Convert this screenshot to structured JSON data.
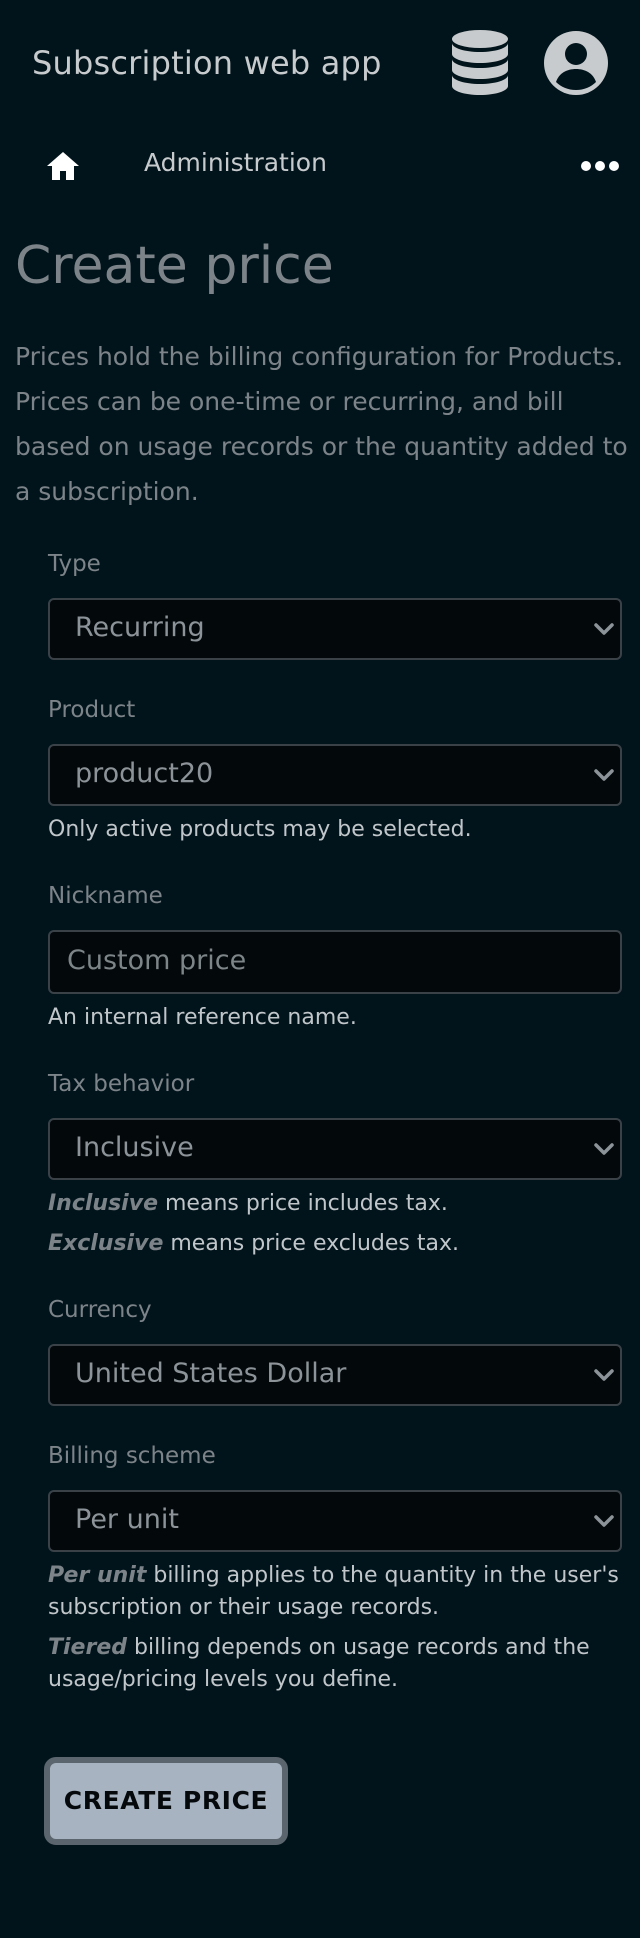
{
  "header": {
    "app_title": "Subscription web app",
    "icons": [
      "database-icon",
      "user-account-icon"
    ]
  },
  "nav": {
    "home_icon": "home-icon",
    "admin_label": "Administration",
    "more_icon": "more-horizontal-icon"
  },
  "page": {
    "title": "Create price",
    "intro": "Prices hold the billing configuration for Products. Prices can be one-time or recurring, and bill based on usage records or the quantity added to a subscription."
  },
  "form": {
    "type": {
      "label": "Type",
      "value": "Recurring"
    },
    "product": {
      "label": "Product",
      "value": "product20",
      "help": "Only active products may be selected."
    },
    "nickname": {
      "label": "Nickname",
      "placeholder": "Custom price",
      "help": "An internal reference name."
    },
    "tax_behavior": {
      "label": "Tax behavior",
      "value": "Inclusive",
      "help_inclusive_term": "Inclusive",
      "help_inclusive_text": " means price includes tax.",
      "help_exclusive_term": "Exclusive",
      "help_exclusive_text": " means price excludes tax."
    },
    "currency": {
      "label": "Currency",
      "value": "United States Dollar"
    },
    "billing_scheme": {
      "label": "Billing scheme",
      "value": "Per unit",
      "help_per_unit_term": "Per unit",
      "help_per_unit_text": " billing applies to the quantity in the user's subscription or their usage records.",
      "help_tiered_term": "Tiered",
      "help_tiered_text": " billing depends on usage records and the usage/pricing levels you define."
    },
    "submit_label": "CREATE PRICE"
  },
  "colors": {
    "background": "#02141b",
    "muted_text": "#7c8489",
    "button_bg": "#a7b3c1",
    "button_border": "#5b656d"
  }
}
